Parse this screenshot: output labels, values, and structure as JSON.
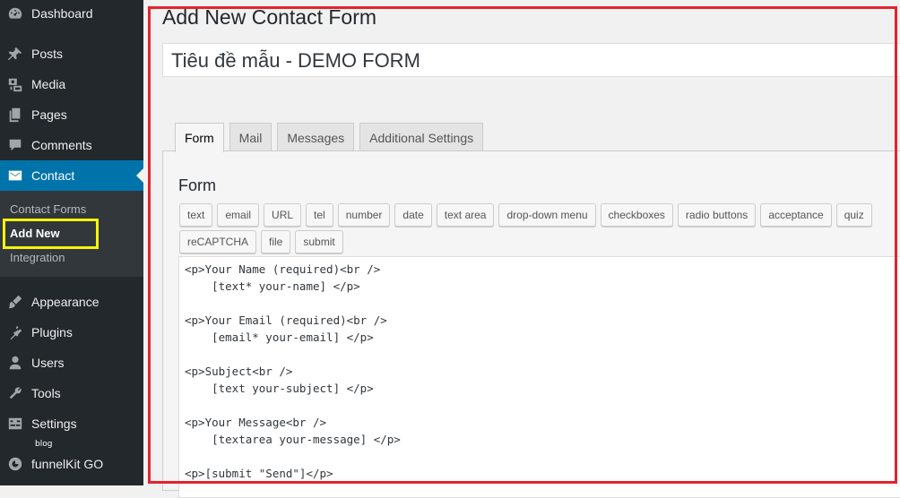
{
  "sidebar": {
    "items": [
      {
        "label": "Dashboard",
        "icon": "dashboard-icon"
      },
      {
        "label": "Posts",
        "icon": "pin-icon"
      },
      {
        "label": "Media",
        "icon": "media-icon"
      },
      {
        "label": "Pages",
        "icon": "pages-icon"
      },
      {
        "label": "Comments",
        "icon": "comments-icon"
      },
      {
        "label": "Contact",
        "icon": "envelope-icon"
      },
      {
        "label": "Appearance",
        "icon": "brush-icon"
      },
      {
        "label": "Plugins",
        "icon": "plugin-icon"
      },
      {
        "label": "Users",
        "icon": "user-icon"
      },
      {
        "label": "Tools",
        "icon": "wrench-icon"
      },
      {
        "label": "Settings",
        "icon": "settings-icon"
      },
      {
        "label": "funnelKit GO",
        "icon": "funnelkit-icon"
      }
    ],
    "submenu": [
      "Contact Forms",
      "Add New",
      "Integration"
    ],
    "mini_label": "blog",
    "active_color": "#0073aa",
    "highlight_color": "#f5f50a"
  },
  "main": {
    "page_title": "Add New Contact Form",
    "form_title_value": "Tiêu đề mẫu - DEMO FORM",
    "tabs": [
      "Form",
      "Mail",
      "Messages",
      "Additional Settings"
    ],
    "panel_heading": "Form",
    "tag_buttons_row1": [
      "text",
      "email",
      "URL",
      "tel",
      "number",
      "date",
      "text area",
      "drop-down menu",
      "checkboxes",
      "radio buttons",
      "acceptance",
      "quiz"
    ],
    "tag_buttons_row2": [
      "reCAPTCHA",
      "file",
      "submit"
    ],
    "code": "<p>Your Name (required)<br />\n    [text* your-name] </p>\n\n<p>Your Email (required)<br />\n    [email* your-email] </p>\n\n<p>Subject<br />\n    [text your-subject] </p>\n\n<p>Your Message<br />\n    [textarea your-message] </p>\n\n<p>[submit \"Send\"]</p>",
    "frame_color": "#e3232c"
  }
}
